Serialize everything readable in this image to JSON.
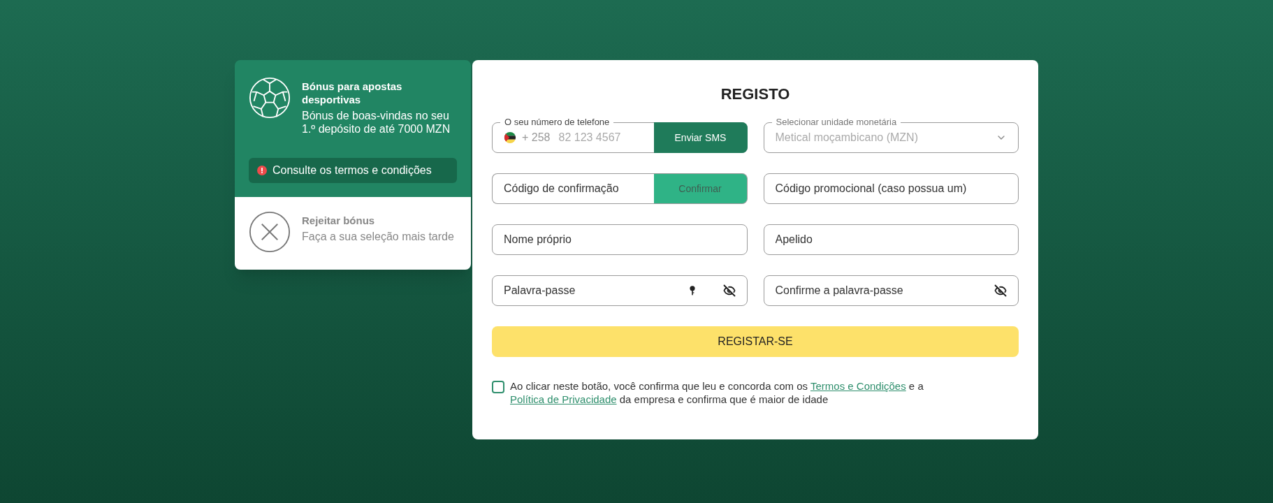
{
  "bonus_options": [
    {
      "kind": "sports",
      "selected": true,
      "title": "Bónus para apostas desportivas",
      "description": "Bónus de boas-vindas no seu 1.º depósito de até 7000 MZN",
      "terms_link": "Consulte os termos e condições"
    },
    {
      "kind": "reject",
      "selected": false,
      "title": "Rejeitar bónus",
      "description": "Faça a sua seleção mais tarde"
    }
  ],
  "form": {
    "title": "REGISTO",
    "fields": [
      {
        "kind": "phone",
        "label": "O seu número de telefone",
        "prefix": "+ 258",
        "placeholder": "82 123 4567",
        "button": "Enviar SMS",
        "disabled": false
      },
      {
        "kind": "select",
        "label": "Selecionar unidade monetária",
        "value": "Metical moçambicano (MZN)"
      },
      {
        "kind": "code",
        "placeholder": "Código de confirmação",
        "button": "Confirmar",
        "disabled": true
      },
      {
        "kind": "text",
        "placeholder": "Código promocional (caso possua um)"
      },
      {
        "kind": "text",
        "placeholder": "Nome próprio"
      },
      {
        "kind": "text",
        "placeholder": "Apelido"
      },
      {
        "kind": "password_generate",
        "placeholder": "Palavra-passe"
      },
      {
        "kind": "password",
        "placeholder": "Confirme a palavra-passe"
      }
    ],
    "submit": "REGISTAR-SE",
    "consent": {
      "checked": false,
      "parts": [
        {
          "kind": "text",
          "text": "Ao clicar neste botão, você confirma que leu e concorda com os "
        },
        {
          "kind": "link",
          "text": "Termos e Condições"
        },
        {
          "kind": "text",
          "text": " e a "
        },
        {
          "kind": "link",
          "text": "Política de Privacidade"
        },
        {
          "kind": "text",
          "text": " da empresa e confirma que é maior de idade"
        }
      ]
    }
  }
}
